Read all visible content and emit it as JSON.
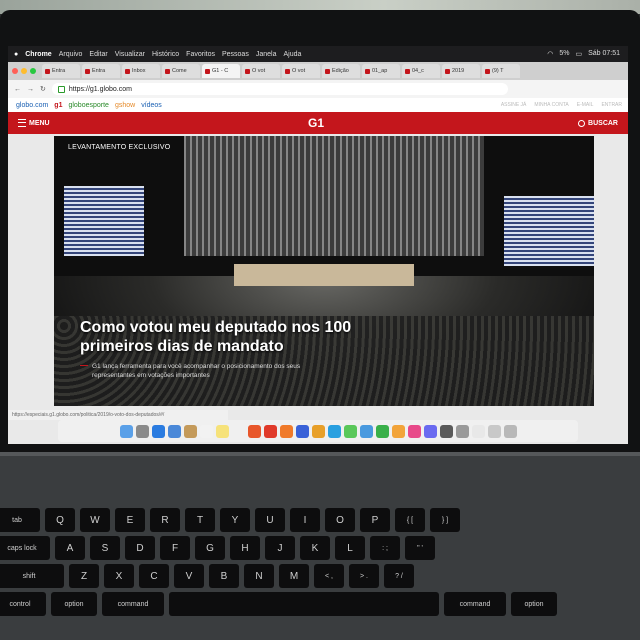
{
  "menubar": {
    "app": "Chrome",
    "items": [
      "Arquivo",
      "Editar",
      "Visualizar",
      "Histórico",
      "Favoritos",
      "Pessoas",
      "Janela",
      "Ajuda"
    ],
    "battery": "5%",
    "clock": "Sáb 07:51"
  },
  "tabs": [
    "Entra",
    "Entra",
    "Inbox",
    "Come",
    "G1 - C",
    "O vot",
    "O vot",
    "Edição",
    "01_ap",
    "04_c",
    "2019",
    "(9) T"
  ],
  "address": {
    "url": "https://g1.globo.com"
  },
  "globonav": {
    "items": [
      "globo.com",
      "g1",
      "globoesporte",
      "gshow",
      "vídeos"
    ],
    "right": [
      "ASSINE JÁ",
      "MINHA CONTA",
      "E-MAIL",
      "ENTRAR"
    ]
  },
  "header": {
    "menu": "MENU",
    "logo": "G1",
    "search": "BUSCAR"
  },
  "hero": {
    "label": "LEVANTAMENTO EXCLUSIVO",
    "title": "Como votou meu deputado nos 100 primeiros dias de mandato",
    "subtitle": "G1 lança ferramenta para você acompanhar o posicionamento dos seus representantes em votações importantes"
  },
  "status": "https://especiais.g1.globo.com/politica/2019/o-voto-dos-deputados/#/",
  "keyboard": {
    "row1": [
      "tab",
      "Q",
      "W",
      "E",
      "R",
      "T",
      "Y",
      "U",
      "I",
      "O",
      "P",
      "{ [",
      "} ]"
    ],
    "row2": [
      "caps lock",
      "A",
      "S",
      "D",
      "F",
      "G",
      "H",
      "J",
      "K",
      "L",
      ": ;",
      "\" '"
    ],
    "row3": [
      "shift",
      "Z",
      "X",
      "C",
      "V",
      "B",
      "N",
      "M",
      "< ,",
      "> .",
      "? /"
    ],
    "row4": [
      "control",
      "option",
      "command",
      "",
      "command",
      "option"
    ]
  },
  "colors": {
    "brand": "#c4161c"
  }
}
